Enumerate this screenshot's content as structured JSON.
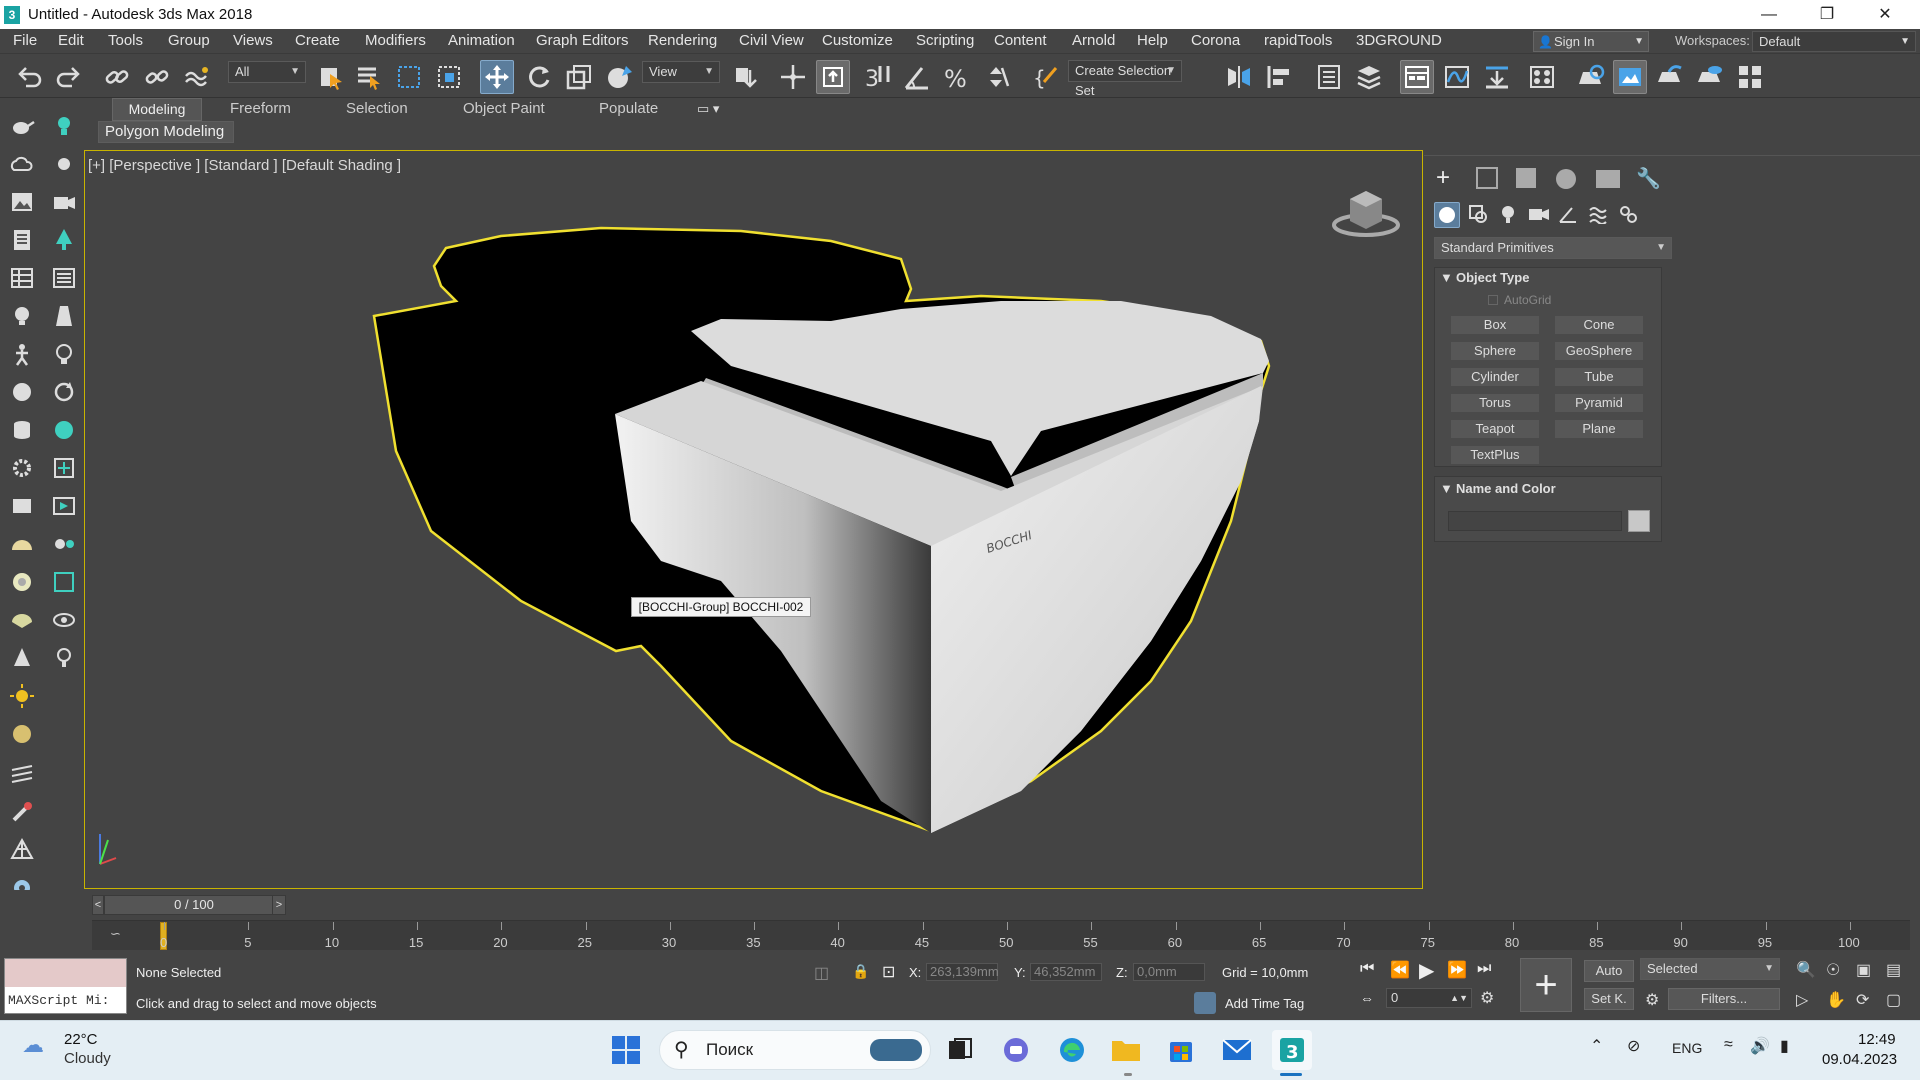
{
  "window": {
    "title": "Untitled - Autodesk 3ds Max 2018",
    "app_icon": "3"
  },
  "menu": [
    "File",
    "Edit",
    "Tools",
    "Group",
    "Views",
    "Create",
    "Modifiers",
    "Animation",
    "Graph Editors",
    "Rendering",
    "Civil View",
    "Customize",
    "Scripting",
    "Content",
    "Arnold",
    "Help",
    "Corona",
    "rapidTools",
    "3DGROUND"
  ],
  "account": {
    "sign_in": "Sign In",
    "workspaces_label": "Workspaces:",
    "workspace": "Default"
  },
  "toolbar": {
    "filter": "All",
    "ref_coord": "View",
    "selection_set": "Create Selection Set"
  },
  "ribbon": {
    "tabs": [
      "Modeling",
      "Freeform",
      "Selection",
      "Object Paint",
      "Populate"
    ],
    "sub": "Polygon Modeling"
  },
  "viewport": {
    "label": "[+] [Perspective ] [Standard ] [Default Shading ]",
    "tooltip": "[BOCCHI-Group] BOCCHI-002",
    "brand": "BOCCHI"
  },
  "command_panel": {
    "category": "Standard Primitives",
    "object_type": "Object Type",
    "autogrid": "AutoGrid",
    "buttons": [
      "Box",
      "Cone",
      "Sphere",
      "GeoSphere",
      "Cylinder",
      "Tube",
      "Torus",
      "Pyramid",
      "Teapot",
      "Plane",
      "TextPlus"
    ],
    "name_and_color": "Name and Color",
    "swatch_color": "#c8c8c8"
  },
  "timeline": {
    "frame_display": "0 / 100",
    "ticks": [
      "0",
      "5",
      "10",
      "15",
      "20",
      "25",
      "30",
      "35",
      "40",
      "45",
      "50",
      "55",
      "60",
      "65",
      "70",
      "75",
      "80",
      "85",
      "90",
      "95",
      "100"
    ]
  },
  "status": {
    "maxscript": "MAXScript Mi:",
    "selection": "None Selected",
    "prompt": "Click and drag to select and move objects",
    "x_label": "X:",
    "x": "263,139mm",
    "y_label": "Y:",
    "y": "46,352mm",
    "z_label": "Z:",
    "z": "0,0mm",
    "grid": "Grid = 10,0mm",
    "add_time_tag": "Add Time Tag",
    "auto": "Auto",
    "set_key": "Set K.",
    "key_filter": "Selected",
    "filters": "Filters...",
    "frame": "0"
  },
  "taskbar": {
    "temp": "22°C",
    "weather": "Cloudy",
    "search": "Поиск",
    "lang": "ENG",
    "time": "12:49",
    "date": "09.04.2023"
  },
  "colors": {
    "selection": "#e8d820",
    "accent": "#5b7d9c",
    "maxscript": "#e4c9c9"
  }
}
